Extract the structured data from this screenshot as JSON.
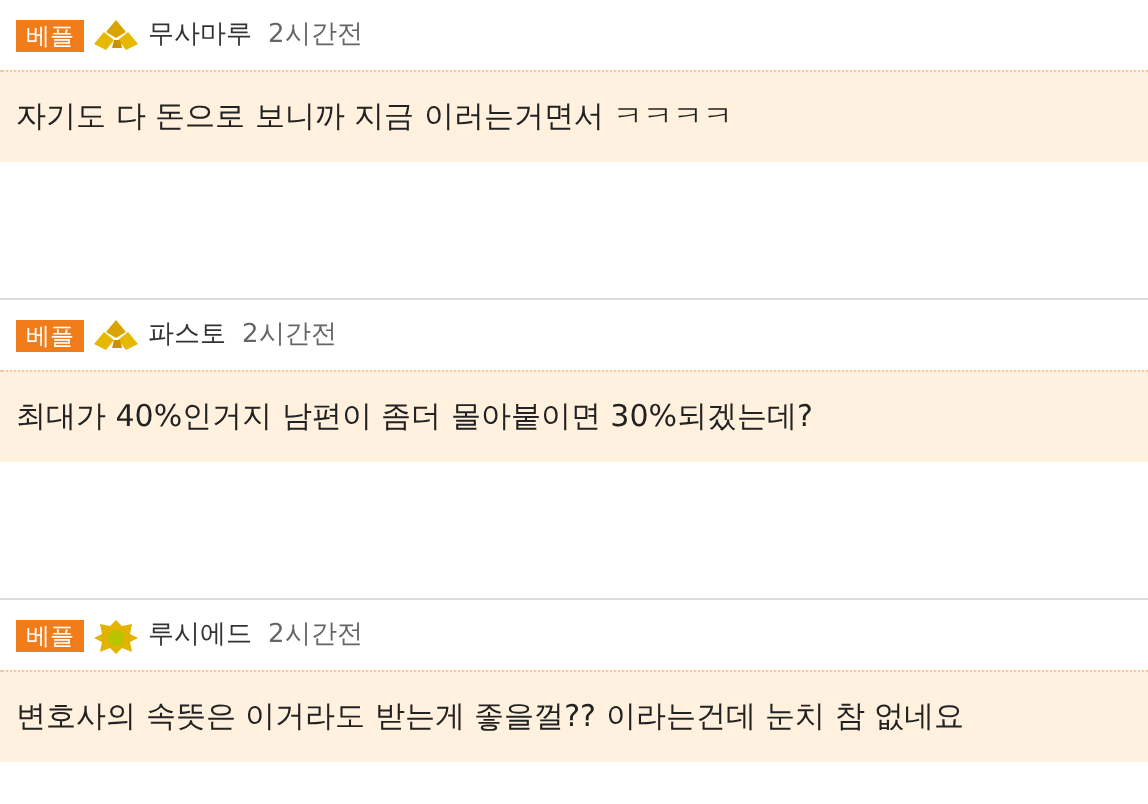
{
  "comments": [
    {
      "badge": "베플",
      "kind": "nuggets",
      "author": "무사마루",
      "time": "2시간전",
      "text": "자기도 다 돈으로 보니까 지금 이러는거면서 ㅋㅋㅋㅋ"
    },
    {
      "badge": "베플",
      "kind": "nuggets",
      "author": "파스토",
      "time": "2시간전",
      "text": "최대가 40%인거지 남편이 좀더 몰아붙이면 30%되겠는데?"
    },
    {
      "badge": "베플",
      "kind": "medal",
      "author": "루시에드",
      "time": "2시간전",
      "text": "변호사의 속뜻은 이거라도 받는게 좋을껄?? 이라는건데 눈치 참 없네요"
    }
  ]
}
